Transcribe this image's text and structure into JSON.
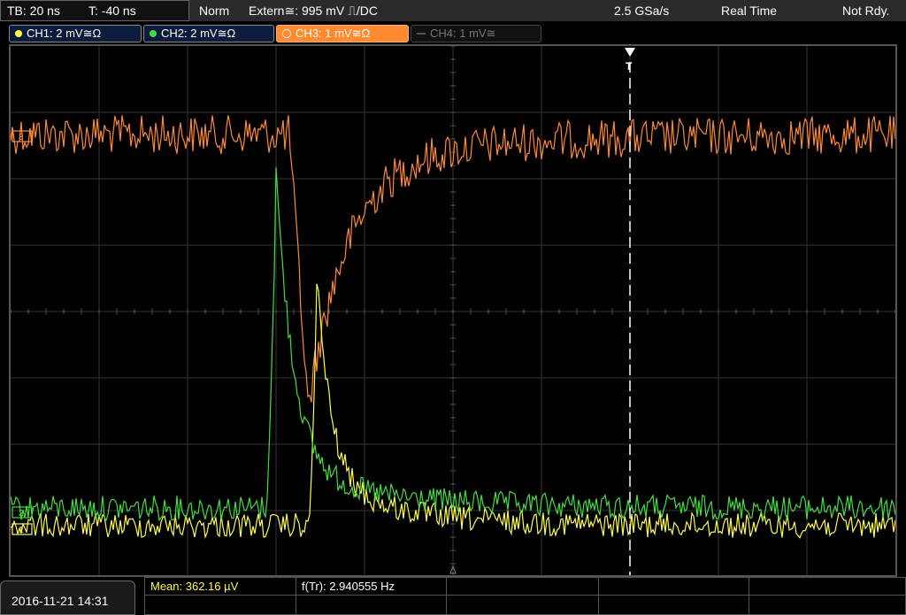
{
  "topbar": {
    "timebase": "TB: 20 ns",
    "trigger_time": "T: -40 ns",
    "trigger_mode": "Norm",
    "trigger_source": "Extern≅: 995 mV ⎍/DC",
    "sample_rate": "2.5 GSa/s",
    "acq_mode": "Real Time",
    "status": "Not Rdy."
  },
  "channels": [
    {
      "label": "CH1: 2 mV≅Ω",
      "color": "#ffff40",
      "active": true
    },
    {
      "label": "CH2: 2 mV≅Ω",
      "color": "#40e040",
      "active": true
    },
    {
      "label": "CH3: 1 mV≅Ω",
      "color": "#ff8a30",
      "active": true,
      "selected": true
    },
    {
      "label": "CH4: 1 mV≅",
      "color": "#666666",
      "active": false
    }
  ],
  "markers": {
    "ch1": "1",
    "ch2": "2",
    "ch3": "3",
    "trigger": "T"
  },
  "measurements": {
    "mean": "Mean: 362.16 µV",
    "freq": "f(Tr): 2.940555 Hz"
  },
  "datetime": "2016-11-21 14:31",
  "colors": {
    "ch1": "#ffff40",
    "ch2": "#40e040",
    "ch3": "#ff8a30",
    "grid": "#3a3a3a",
    "trigger_line": "#ffffff"
  }
}
